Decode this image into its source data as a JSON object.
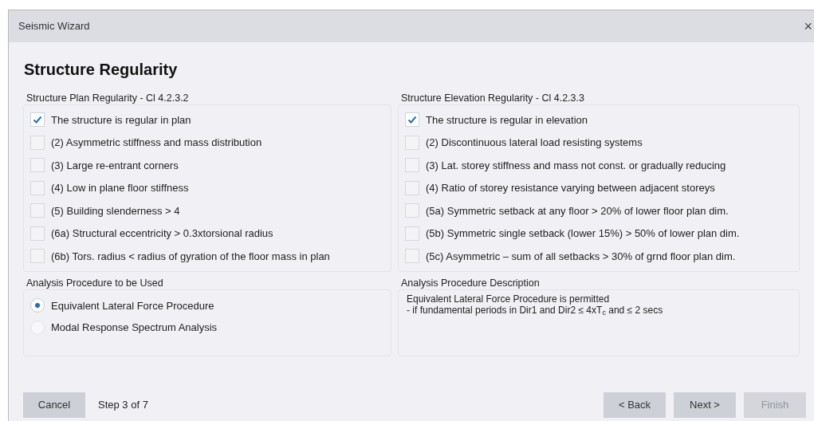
{
  "window": {
    "title": "Seismic Wizard",
    "close": "×"
  },
  "heading": "Structure Regularity",
  "plan_group": {
    "title": "Structure Plan Regularity - Cl 4.2.3.2",
    "items": [
      {
        "label": "The structure is regular in plan",
        "checked": true
      },
      {
        "label": "(2) Asymmetric stiffness and mass distribution",
        "checked": false
      },
      {
        "label": "(3) Large re-entrant corners",
        "checked": false
      },
      {
        "label": "(4) Low in plane floor stiffness",
        "checked": false
      },
      {
        "label": "(5) Building slenderness > 4",
        "checked": false
      },
      {
        "label": "(6a) Structural eccentricity > 0.3xtorsional radius",
        "checked": false
      },
      {
        "label": "(6b) Tors. radius < radius of gyration of the floor mass in plan",
        "checked": false
      }
    ]
  },
  "elevation_group": {
    "title": "Structure Elevation Regularity - Cl 4.2.3.3",
    "items": [
      {
        "label": "The structure is regular in elevation",
        "checked": true
      },
      {
        "label": "(2) Discontinuous lateral load resisting systems",
        "checked": false
      },
      {
        "label": "(3) Lat. storey stiffness and mass not const. or gradually reducing",
        "checked": false
      },
      {
        "label": "(4) Ratio of storey resistance varying between adjacent storeys",
        "checked": false
      },
      {
        "label": "(5a) Symmetric setback at any floor > 20% of lower floor plan dim.",
        "checked": false
      },
      {
        "label": "(5b) Symmetric single setback (lower 15%) > 50% of lower plan dim.",
        "checked": false
      },
      {
        "label": "(5c) Asymmetric – sum of all setbacks > 30% of grnd floor plan dim.",
        "checked": false
      }
    ]
  },
  "procedure_group": {
    "title": "Analysis Procedure to be Used",
    "options": [
      {
        "label": "Equivalent Lateral Force Procedure",
        "selected": true
      },
      {
        "label": "Modal Response Spectrum Analysis",
        "selected": false
      }
    ]
  },
  "description_group": {
    "title": "Analysis Procedure Description",
    "lines": [
      "Equivalent Lateral Force Procedure is permitted",
      "- if fundamental periods in Dir1 and Dir2 ≤ 4xT$_{c}$ and ≤ 2 secs"
    ]
  },
  "footer": {
    "cancel": "Cancel",
    "step": "Step 3 of 7",
    "buttons": [
      {
        "label": "< Back",
        "disabled": false
      },
      {
        "label": "Next >",
        "disabled": false
      },
      {
        "label": "Finish",
        "disabled": true
      }
    ]
  }
}
